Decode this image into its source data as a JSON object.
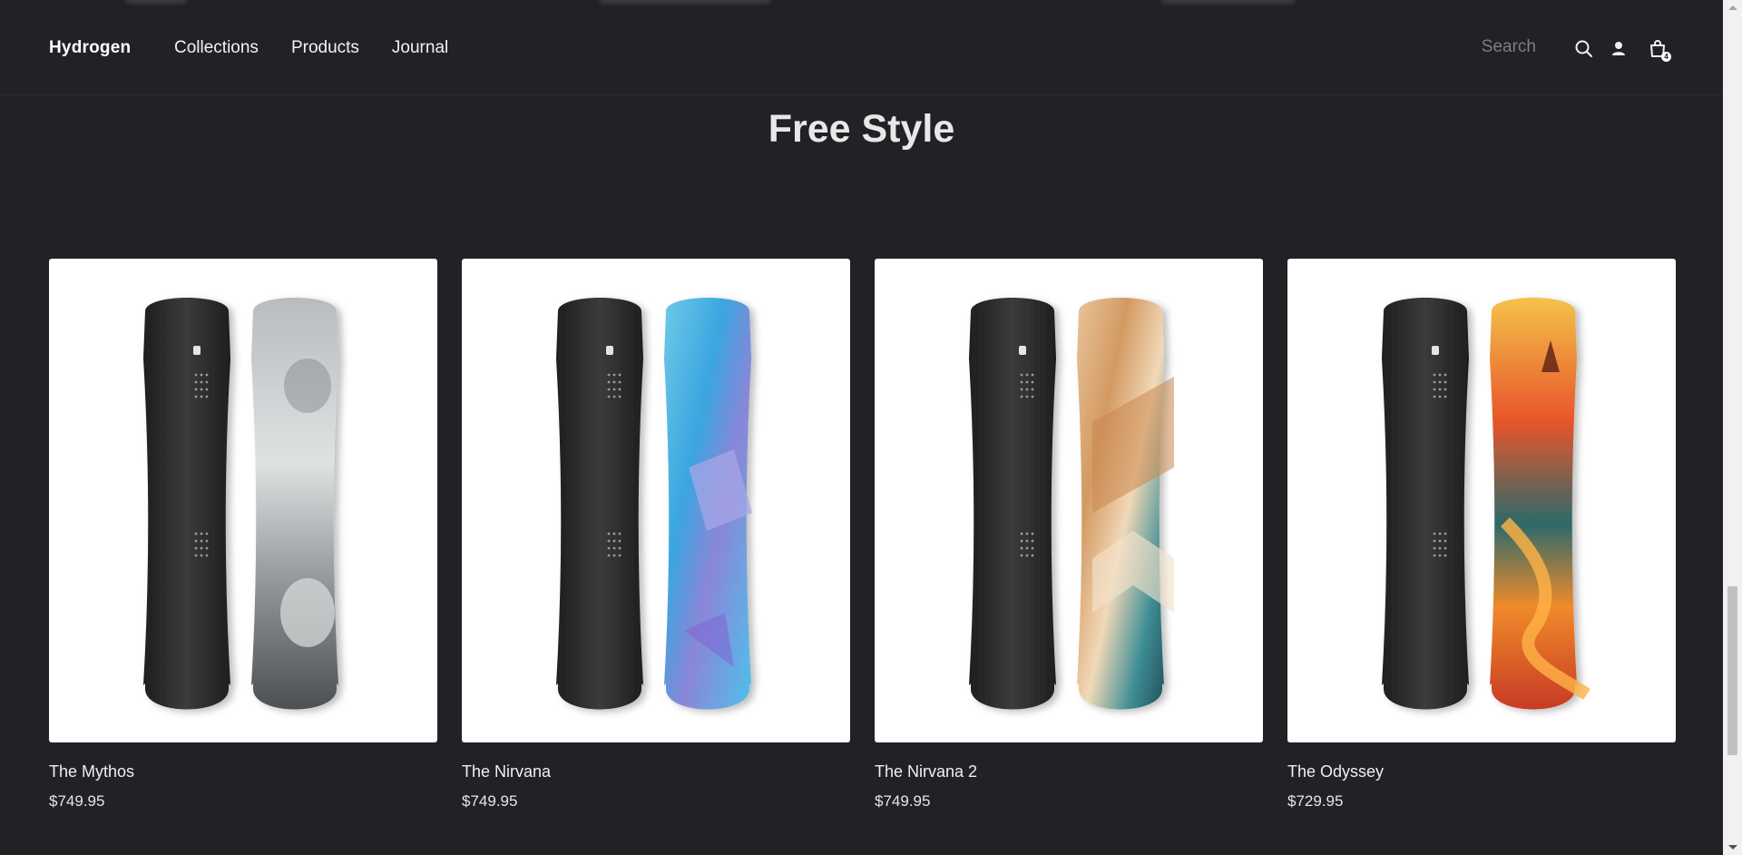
{
  "header": {
    "brand": "Hydrogen",
    "nav": [
      "Collections",
      "Products",
      "Journal"
    ],
    "search_placeholder": "Search",
    "icons": [
      "search-icon",
      "account-icon",
      "cart-icon"
    ],
    "cart_count": "4"
  },
  "section": {
    "title": "Free Style"
  },
  "products": [
    {
      "name": "The Mythos",
      "price": "$749.95",
      "art": "mythos"
    },
    {
      "name": "The Nirvana",
      "price": "$749.95",
      "art": "nirvana"
    },
    {
      "name": "The Nirvana 2",
      "price": "$749.95",
      "art": "nirvana2"
    },
    {
      "name": "The Odyssey",
      "price": "$729.95",
      "art": "odyssey"
    }
  ],
  "colors": {
    "background": "#212226",
    "card": "#ffffff",
    "text": "#e8e8e8"
  }
}
